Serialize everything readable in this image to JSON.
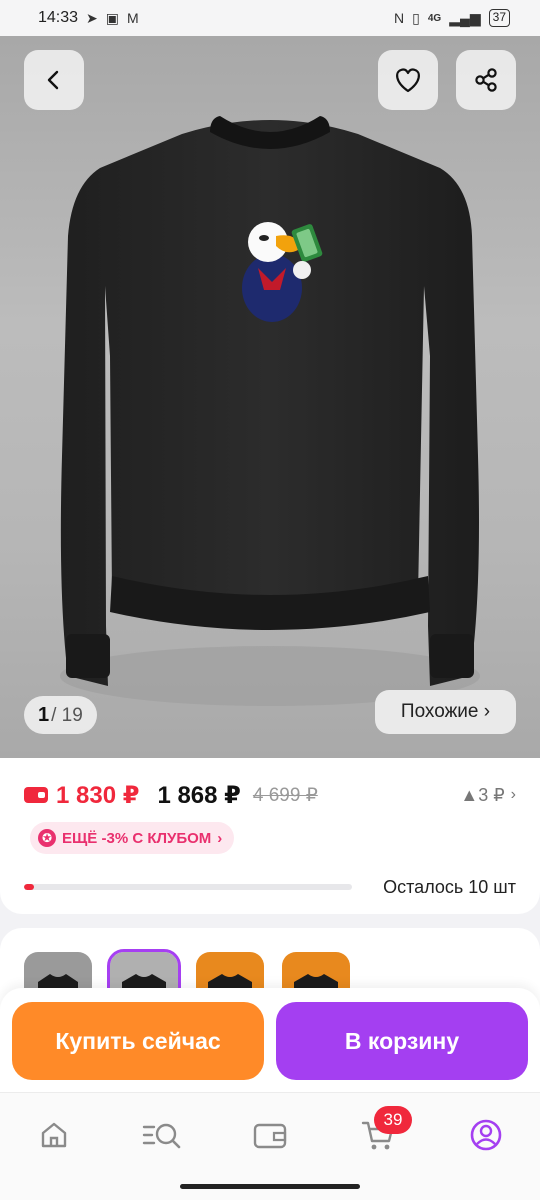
{
  "status_bar": {
    "time": "14:33",
    "network": "4G",
    "battery": "37"
  },
  "gallery": {
    "current": "1",
    "total": "/ 19",
    "similar_label": "Похожие ›"
  },
  "price": {
    "wallet_price": "1 830 ₽",
    "current_price": "1 868 ₽",
    "old_price": "4 699 ₽",
    "cashback": "▲3 ₽",
    "cashback_arrow": "›"
  },
  "club": {
    "label": "ЕЩЁ -3% С КЛУБОМ",
    "arrow": "›"
  },
  "stock": {
    "text": "Осталось 10 шт",
    "fraction": 0.03
  },
  "variants": {
    "count": 4,
    "selected_index": 1
  },
  "actions": {
    "buy_now": "Купить сейчас",
    "add_to_cart": "В корзину"
  },
  "bottom_nav": {
    "items": [
      "home-icon",
      "catalog-search-icon",
      "wallet-icon",
      "cart-icon",
      "profile-icon"
    ],
    "cart_badge": "39"
  },
  "colors": {
    "accent_red": "#f0283c",
    "club_pink": "#e9306e",
    "buy_orange": "#ff8a28",
    "cart_purple": "#a43ff1"
  }
}
